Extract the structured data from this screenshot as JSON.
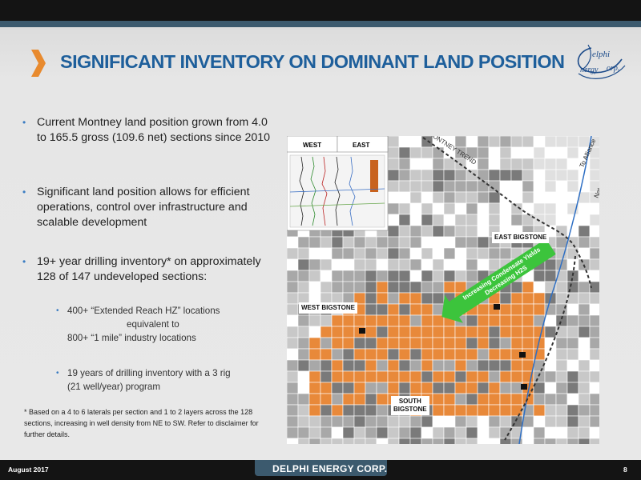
{
  "slide": {
    "title": "SIGNIFICANT INVENTORY ON DOMINANT LAND POSITION",
    "accent_color": "#1e5f9b",
    "chevron_color": "#e88a2e"
  },
  "logo": {
    "line1": "elphi",
    "line2": "nergy",
    "line3": "orp."
  },
  "bullets": [
    "Current Montney land position grown from 4.0 to 165.5 gross (109.6 net) sections since 2010",
    "Significant land position allows for efficient operations, control over infrastructure and scalable development",
    "19+ year drilling inventory* on approximately 128 of 147 undeveloped sections:"
  ],
  "sub_bullets": [
    {
      "line1": "400+ “Extended Reach HZ” locations",
      "line2": "equivalent to",
      "line3": "800+ “1 mile” industry locations"
    },
    {
      "line1": "19 years of drilling inventory with a 3 rig",
      "line2": "(21 well/year) program"
    }
  ],
  "footnote": "* Based on a 4 to 6 laterals per section and 1 to 2 layers across the 128 sections, increasing in well density from NE to SW. Refer to disclaimer for further details.",
  "map": {
    "log_labels": {
      "west": "WEST",
      "east": "EAST"
    },
    "trend_label": "MONTNEY TREND",
    "pipeline_label_1": "To Alliance",
    "pipeline_label_2": "Nat. to Thunbone",
    "east_label": "EAST BIGSTONE",
    "west_label": "WEST BIGSTONE",
    "south_label_1": "SOUTH",
    "south_label_2": "BIGSTONE",
    "arrow_line_1": "Increasing Condensate Yields",
    "arrow_line_2": "Decreasing H2S",
    "orange": "#e8893a",
    "arrow_color": "#3cc43c"
  },
  "footer": {
    "date": "August 2017",
    "brand": "DELPHI ENERGY CORP.",
    "page": "8"
  }
}
